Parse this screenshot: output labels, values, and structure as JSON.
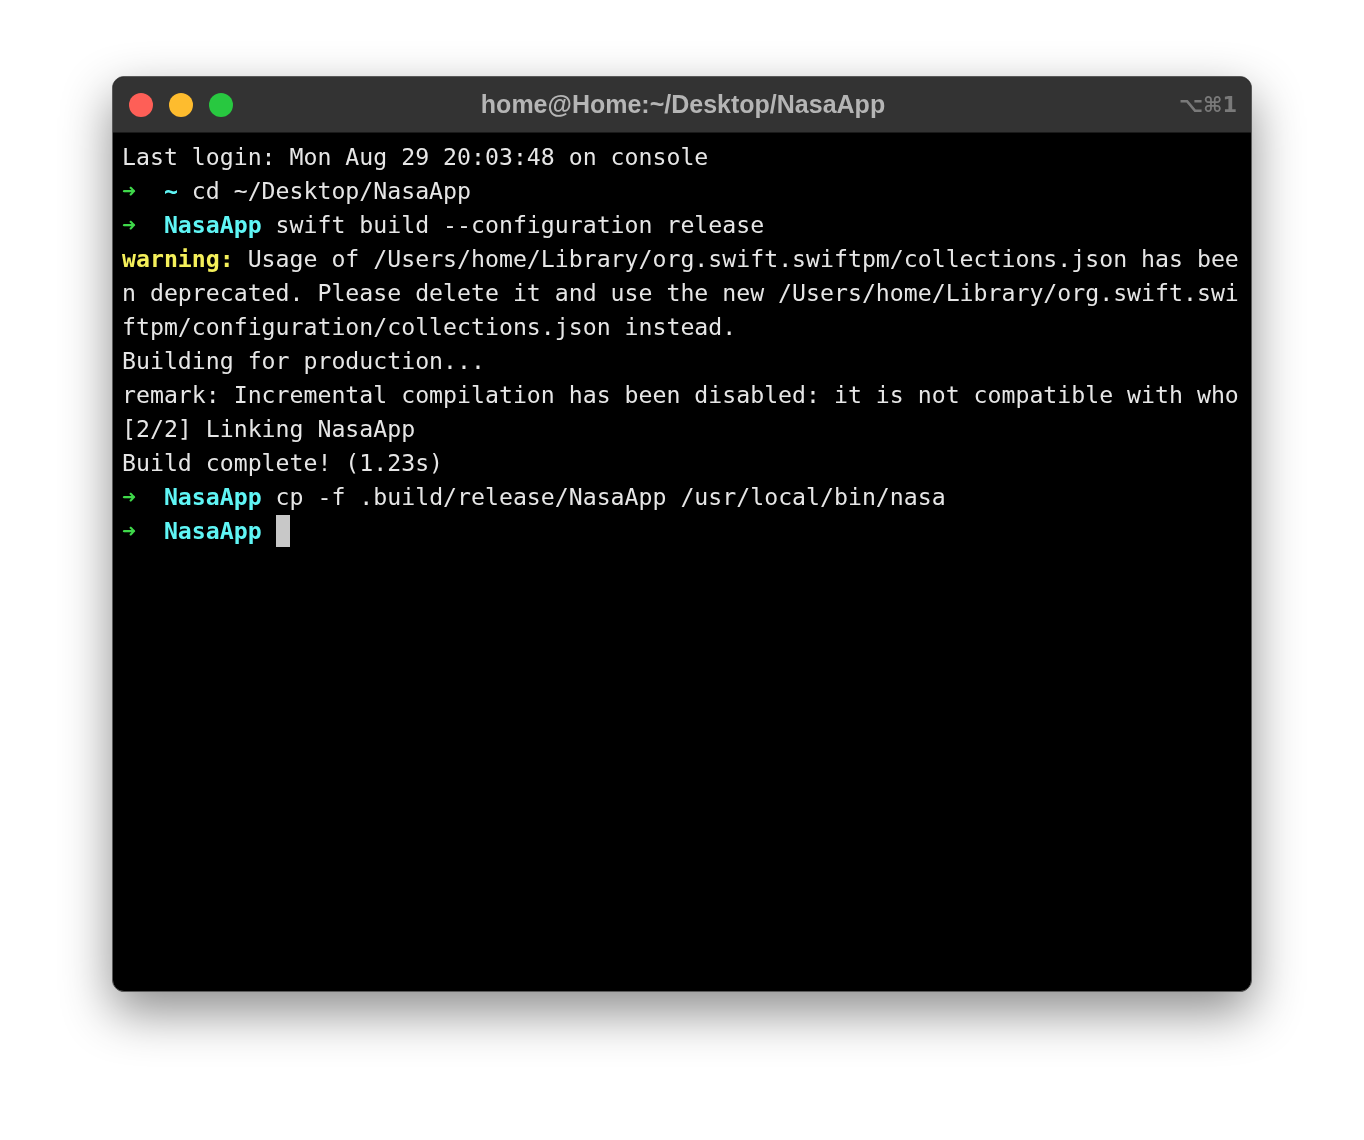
{
  "window": {
    "title": "home@Home:~/Desktop/NasaApp",
    "shortcut": "⌥⌘1"
  },
  "terminal": {
    "lines": [
      {
        "segments": [
          {
            "kind": "plain",
            "text": "Last login: Mon Aug 29 20:03:48 on console"
          }
        ]
      },
      {
        "segments": [
          {
            "kind": "arrow",
            "text": "➜"
          },
          {
            "kind": "dir",
            "text": "~"
          },
          {
            "kind": "plain",
            "text": " cd ~/Desktop/NasaApp"
          }
        ]
      },
      {
        "segments": [
          {
            "kind": "arrow",
            "text": "➜"
          },
          {
            "kind": "dir",
            "text": "NasaApp"
          },
          {
            "kind": "plain",
            "text": " swift build --configuration release"
          }
        ]
      },
      {
        "segments": [
          {
            "kind": "warning",
            "text": "warning:"
          },
          {
            "kind": "plain",
            "text": " Usage of /Users/home/Library/org.swift.swiftpm/collections.json has bee"
          }
        ]
      },
      {
        "segments": [
          {
            "kind": "plain",
            "text": "n deprecated. Please delete it and use the new /Users/home/Library/org.swift.swi"
          }
        ]
      },
      {
        "segments": [
          {
            "kind": "plain",
            "text": "ftpm/configuration/collections.json instead."
          }
        ]
      },
      {
        "segments": [
          {
            "kind": "plain",
            "text": "Building for production..."
          }
        ]
      },
      {
        "segments": [
          {
            "kind": "plain",
            "text": "remark: Incremental compilation has been disabled: it is not compatible with who"
          }
        ]
      },
      {
        "segments": [
          {
            "kind": "plain",
            "text": "[2/2] Linking NasaApp"
          }
        ]
      },
      {
        "segments": [
          {
            "kind": "plain",
            "text": "Build complete! (1.23s)"
          }
        ]
      },
      {
        "segments": [
          {
            "kind": "arrow",
            "text": "➜"
          },
          {
            "kind": "dir",
            "text": "NasaApp"
          },
          {
            "kind": "plain",
            "text": " cp -f .build/release/NasaApp /usr/local/bin/nasa"
          }
        ]
      },
      {
        "segments": [
          {
            "kind": "arrow",
            "text": "➜"
          },
          {
            "kind": "dir",
            "text": "NasaApp"
          }
        ],
        "cursor": true
      }
    ]
  }
}
